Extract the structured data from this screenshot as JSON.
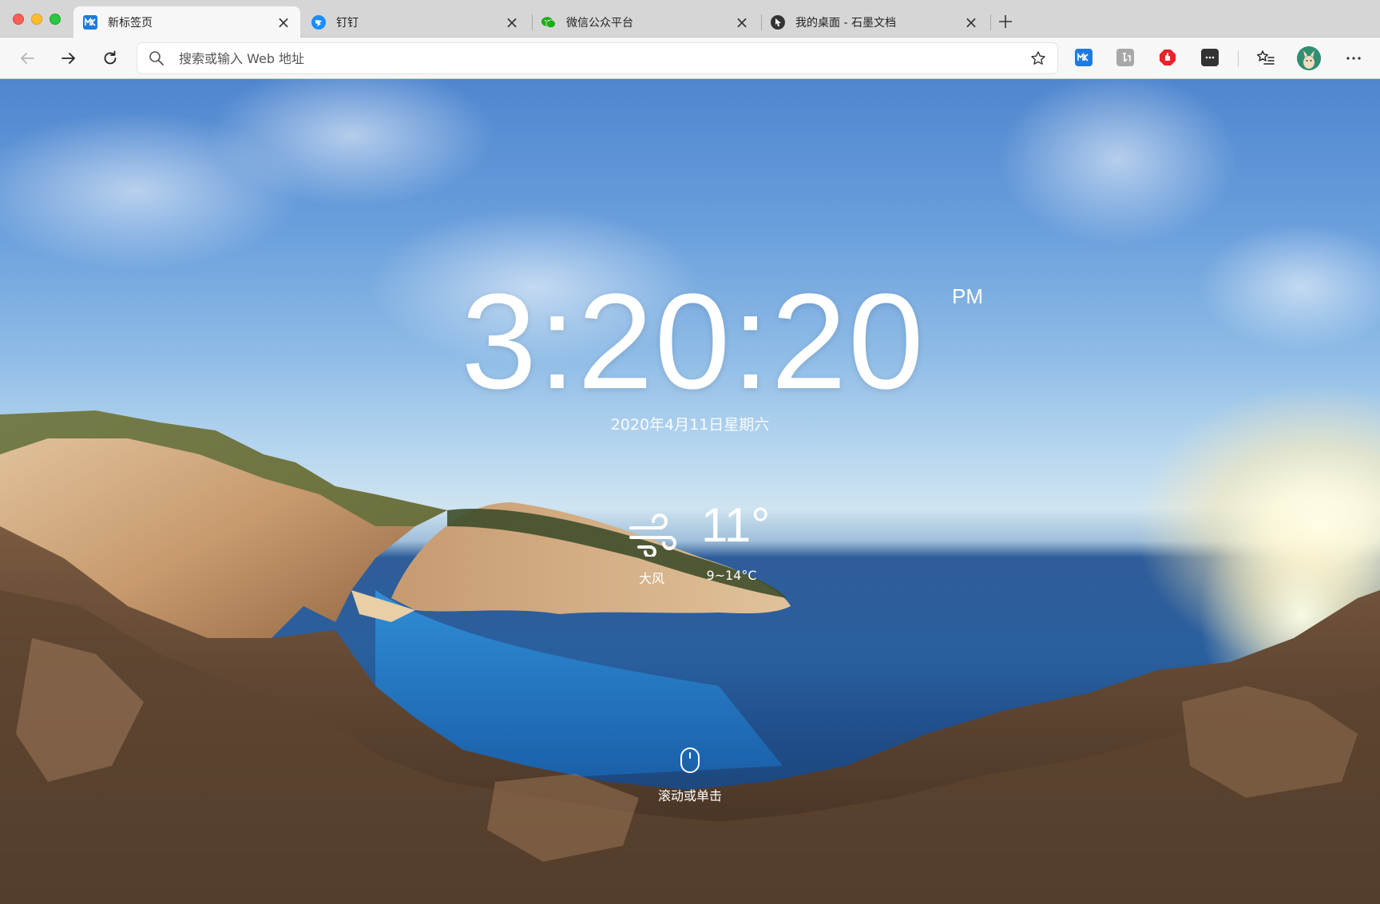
{
  "tabs": [
    {
      "title": "新标签页",
      "favicon": "mk-icon",
      "favicon_text": "MK",
      "favicon_color": "#1e7be0",
      "active": true
    },
    {
      "title": "钉钉",
      "favicon": "dingtalk-icon",
      "favicon_color": "#1a8cff",
      "active": false
    },
    {
      "title": "微信公众平台",
      "favicon": "wechat-icon",
      "favicon_color": "#1aad19",
      "active": false
    },
    {
      "title": "我的桌面 - 石墨文档",
      "favicon": "shimo-icon",
      "favicon_color": "#333333",
      "active": false
    }
  ],
  "toolbar": {
    "address_placeholder": "搜索或输入 Web 地址",
    "extensions": [
      {
        "name": "mk-extension-icon",
        "text": "MK",
        "color": "#1e7be0"
      },
      {
        "name": "translate-extension-icon",
        "text": "",
        "color": "#a8a8a8"
      },
      {
        "name": "adblock-extension-icon",
        "text": "",
        "color": "#e8232a"
      },
      {
        "name": "password-extension-icon",
        "text": "",
        "color": "#333333"
      }
    ]
  },
  "newtab": {
    "time": "3:20:20",
    "ampm": "PM",
    "date": "2020年4月11日星期六",
    "weather": {
      "condition": "大风",
      "temperature": "11°",
      "range": "9~14°C"
    },
    "scroll_hint": "滚动或单击"
  }
}
